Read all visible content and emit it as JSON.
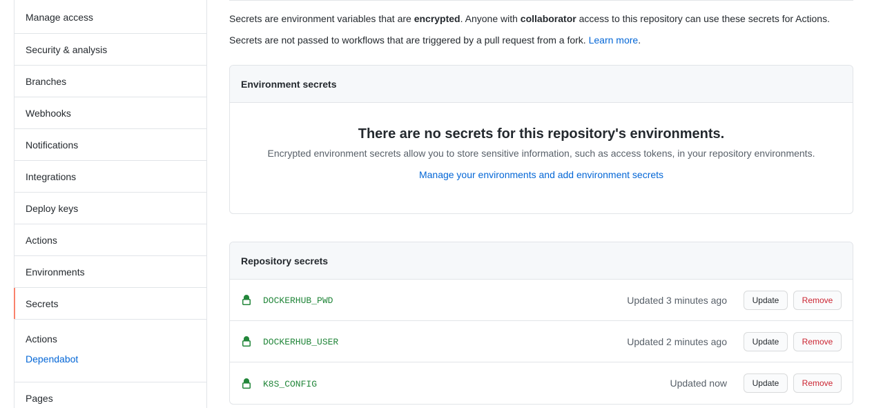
{
  "sidebar": {
    "items": [
      {
        "label": "Manage access"
      },
      {
        "label": "Security & analysis"
      },
      {
        "label": "Branches"
      },
      {
        "label": "Webhooks"
      },
      {
        "label": "Notifications"
      },
      {
        "label": "Integrations"
      },
      {
        "label": "Deploy keys"
      },
      {
        "label": "Actions"
      },
      {
        "label": "Environments"
      },
      {
        "label": "Secrets"
      }
    ],
    "sub": {
      "heading": "Actions",
      "link": "Dependabot"
    },
    "last_item": "Pages"
  },
  "main": {
    "intro": {
      "p1_before": "Secrets are environment variables that are ",
      "p1_bold1": "encrypted",
      "p1_middle": ". Anyone with ",
      "p1_bold2": "collaborator",
      "p1_after": " access to this repository can use these secrets for Actions.",
      "p2_text": "Secrets are not passed to workflows that are triggered by a pull request from a fork. ",
      "p2_link": "Learn more",
      "p2_end": "."
    },
    "environment_secrets": {
      "title": "Environment secrets",
      "blank_heading": "There are no secrets for this repository's environments.",
      "blank_text": "Encrypted environment secrets allow you to store sensitive information, such as access tokens, in your repository environments.",
      "blank_link": "Manage your environments and add environment secrets"
    },
    "repository_secrets": {
      "title": "Repository secrets",
      "rows": [
        {
          "name": "DOCKERHUB_PWD",
          "updated": "Updated 3 minutes ago",
          "update_label": "Update",
          "remove_label": "Remove"
        },
        {
          "name": "DOCKERHUB_USER",
          "updated": "Updated 2 minutes ago",
          "update_label": "Update",
          "remove_label": "Remove"
        },
        {
          "name": "K8S_CONFIG",
          "updated": "Updated now",
          "update_label": "Update",
          "remove_label": "Remove"
        }
      ]
    }
  },
  "colors": {
    "link": "#0366d6",
    "secret_name": "#22863a",
    "remove": "#cb2431",
    "selected_indicator": "#f9826c"
  },
  "icons": {
    "secret_row": "lock-icon"
  }
}
